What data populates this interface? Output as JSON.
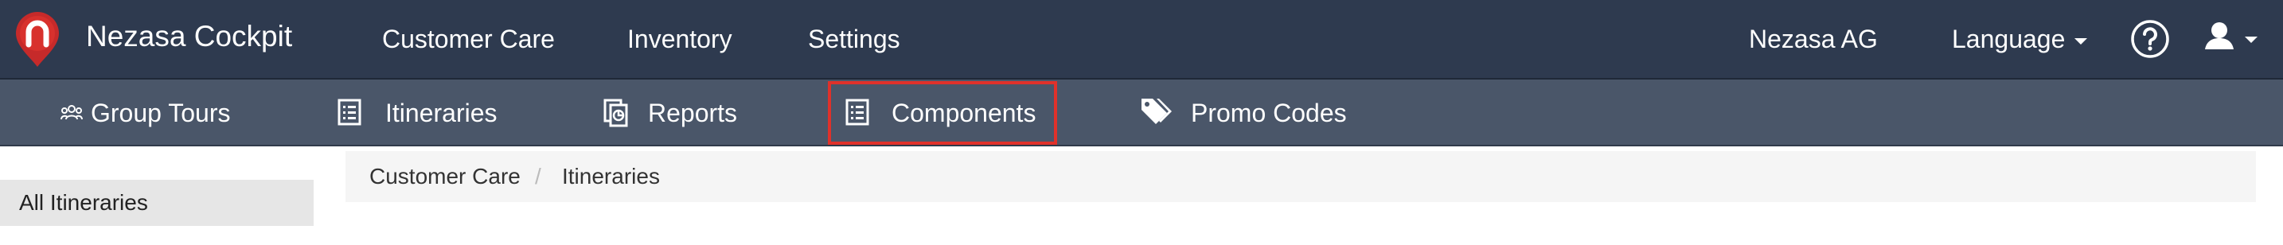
{
  "app": {
    "title": "Nezasa Cockpit"
  },
  "topnav": {
    "items": [
      {
        "label": "Customer Care"
      },
      {
        "label": "Inventory"
      },
      {
        "label": "Settings"
      }
    ],
    "account": "Nezasa AG",
    "language": "Language",
    "help_icon": "question-circle-icon",
    "user_icon": "user-icon"
  },
  "subnav": {
    "items": [
      {
        "label": "Group Tours",
        "icon": "group-icon"
      },
      {
        "label": "Itineraries",
        "icon": "list-icon"
      },
      {
        "label": "Reports",
        "icon": "report-icon"
      },
      {
        "label": "Components",
        "icon": "list-icon",
        "highlighted": true
      },
      {
        "label": "Promo Codes",
        "icon": "tags-icon"
      }
    ]
  },
  "sidebar": {
    "items": [
      {
        "label": "All Itineraries"
      }
    ]
  },
  "breadcrumb": {
    "items": [
      {
        "label": "Customer Care"
      },
      {
        "label": "Itineraries"
      }
    ],
    "separator": "/"
  },
  "colors": {
    "topbar": "#2e3a4f",
    "subnav": "#4a5669",
    "highlight": "#e0312a",
    "logo": "#d42e2e"
  }
}
